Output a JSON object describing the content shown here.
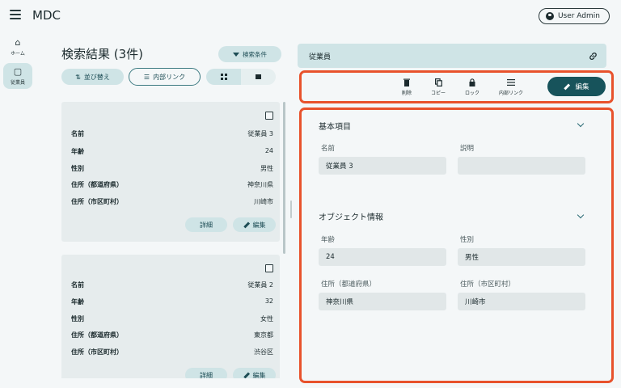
{
  "app": {
    "title": "MDC",
    "user_label": "User Admin"
  },
  "rail": {
    "items": [
      {
        "label": "ホーム",
        "glyph": "⌂"
      },
      {
        "label": "従業員",
        "glyph": "▢"
      }
    ]
  },
  "list": {
    "title": "検索結果 (3件)",
    "search_condition_label": "検索条件",
    "sort_label": "並び替え",
    "internal_link_label": "内部リンク",
    "cards": [
      {
        "rows": [
          {
            "k": "名前",
            "v": "従業員 3"
          },
          {
            "k": "年齢",
            "v": "24"
          },
          {
            "k": "性別",
            "v": "男性"
          },
          {
            "k": "住所（都道府県）",
            "v": "神奈川県"
          },
          {
            "k": "住所（市区町村）",
            "v": "川崎市"
          }
        ],
        "detail_label": "詳細",
        "edit_label": "編集"
      },
      {
        "rows": [
          {
            "k": "名前",
            "v": "従業員 2"
          },
          {
            "k": "年齢",
            "v": "32"
          },
          {
            "k": "性別",
            "v": "女性"
          },
          {
            "k": "住所（都道府県）",
            "v": "東京都"
          },
          {
            "k": "住所（市区町村）",
            "v": "渋谷区"
          }
        ],
        "detail_label": "詳細",
        "edit_label": "編集"
      }
    ]
  },
  "detail": {
    "header_title": "従業員",
    "toolbar": {
      "delete_label": "削除",
      "copy_label": "コピー",
      "lock_label": "ロック",
      "link_label": "内部リンク",
      "edit_label": "編集"
    },
    "sections": [
      {
        "title": "基本項目",
        "fields": [
          {
            "label": "名前",
            "value": "従業員 3"
          },
          {
            "label": "説明",
            "value": ""
          }
        ]
      },
      {
        "title": "オブジェクト情報",
        "fields": [
          {
            "label": "年齢",
            "value": "24"
          },
          {
            "label": "性別",
            "value": "男性"
          },
          {
            "label": "住所（都道府県）",
            "value": "神奈川県"
          },
          {
            "label": "住所（市区町村）",
            "value": "川崎市"
          }
        ]
      }
    ]
  },
  "colors": {
    "accent": "#17535b",
    "highlight": "#e8522c",
    "tonal": "#cfe4e6"
  }
}
